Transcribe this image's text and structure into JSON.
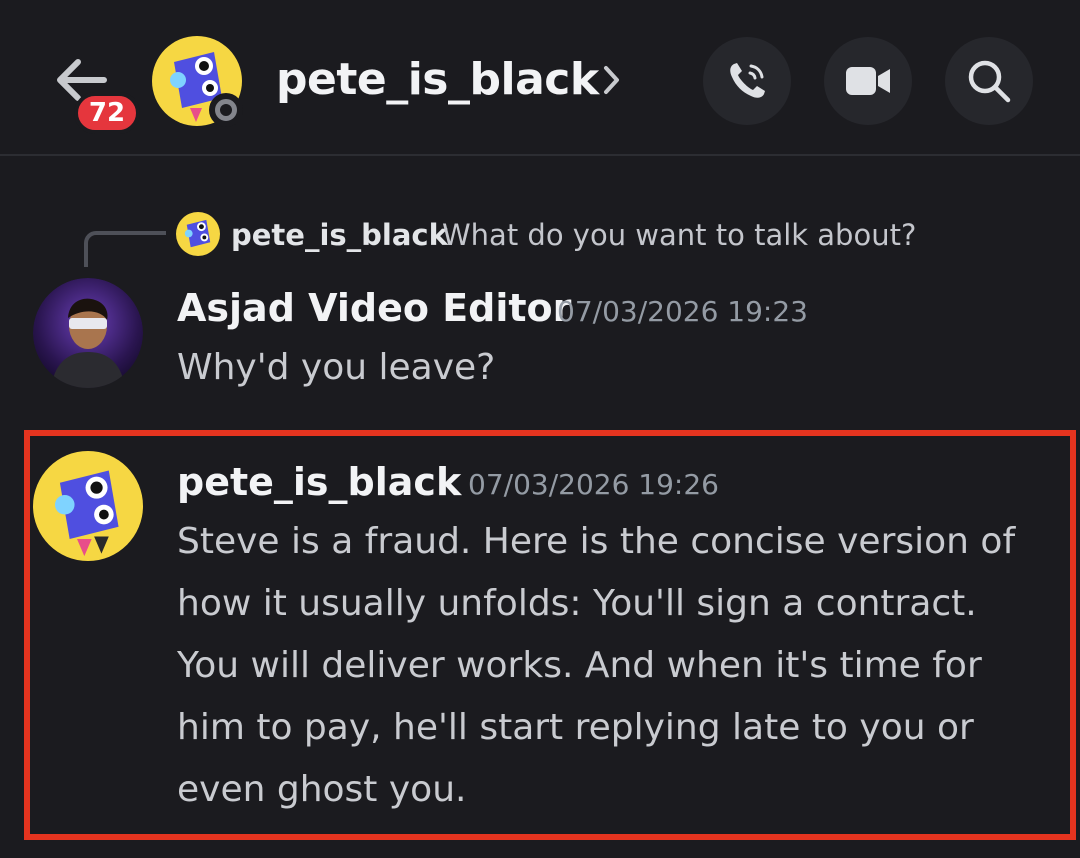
{
  "header": {
    "unread_count": "72",
    "title": "pete_is_black"
  },
  "reply": {
    "author": "pete_is_black",
    "text": "What do you want to talk about?"
  },
  "messages": [
    {
      "author": "Asjad Video Editor",
      "timestamp": "07/03/2026 19:23",
      "lines": [
        "Why'd you leave?"
      ]
    },
    {
      "author": "pete_is_black",
      "timestamp": "07/03/2026 19:26",
      "lines": [
        "Steve is a fraud. Here is the concise version of",
        "how it usually unfolds: You'll sign a contract.",
        "You will deliver works. And when it's time for",
        "him to pay, he'll start replying late to you or",
        "even ghost you."
      ]
    }
  ],
  "colors": {
    "background": "#1b1b1f",
    "badge": "#e5363d",
    "highlight_border": "#e5341f",
    "avatar_yellow": "#f6d743",
    "avatar_blue": "#4f4fe0"
  },
  "icons": {
    "back": "arrow-left-icon",
    "call": "phone-icon",
    "video": "video-camera-icon",
    "search": "search-icon",
    "chevron": "chevron-right-icon"
  }
}
